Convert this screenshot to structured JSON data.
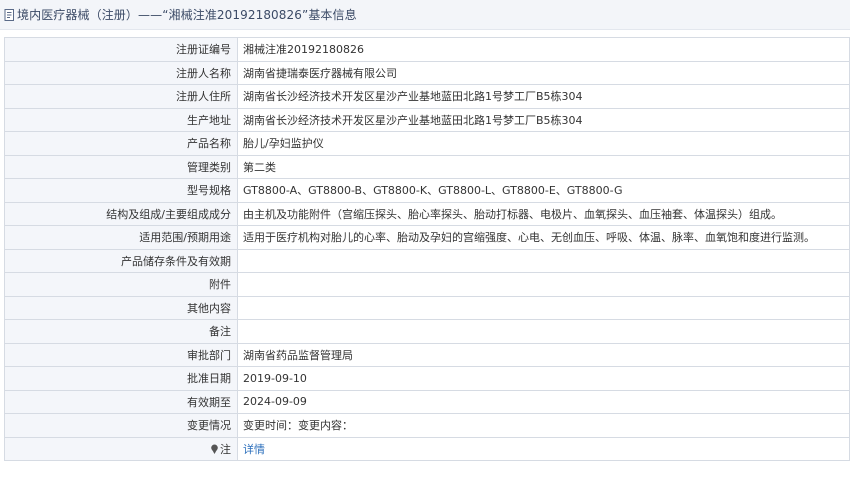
{
  "header": {
    "title": "境内医疗器械（注册）——“湘械注准20192180826”基本信息"
  },
  "rows": [
    {
      "label": "注册证编号",
      "value": "湘械注准20192180826"
    },
    {
      "label": "注册人名称",
      "value": "湖南省捷瑞泰医疗器械有限公司"
    },
    {
      "label": "注册人住所",
      "value": "湖南省长沙经济技术开发区星沙产业基地蓝田北路1号梦工厂B5栋304"
    },
    {
      "label": "生产地址",
      "value": "湖南省长沙经济技术开发区星沙产业基地蓝田北路1号梦工厂B5栋304"
    },
    {
      "label": "产品名称",
      "value": "胎儿/孕妇监护仪"
    },
    {
      "label": "管理类别",
      "value": "第二类"
    },
    {
      "label": "型号规格",
      "value": "GT8800-A、GT8800-B、GT8800-K、GT8800-L、GT8800-E、GT8800-G"
    },
    {
      "label": "结构及组成/主要组成成分",
      "value": "由主机及功能附件（宫缩压探头、胎心率探头、胎动打标器、电极片、血氧探头、血压袖套、体温探头）组成。"
    },
    {
      "label": "适用范围/预期用途",
      "value": "适用于医疗机构对胎儿的心率、胎动及孕妇的宫缩强度、心电、无创血压、呼吸、体温、脉率、血氧饱和度进行监测。"
    },
    {
      "label": "产品储存条件及有效期",
      "value": ""
    },
    {
      "label": "附件",
      "value": ""
    },
    {
      "label": "其他内容",
      "value": ""
    },
    {
      "label": "备注",
      "value": ""
    },
    {
      "label": "审批部门",
      "value": "湖南省药品监督管理局"
    },
    {
      "label": "批准日期",
      "value": "2019-09-10"
    },
    {
      "label": "有效期至",
      "value": "2024-09-09"
    },
    {
      "label": "变更情况",
      "value": "变更时间：变更内容："
    }
  ],
  "note_row": {
    "label": "注",
    "link_text": "详情",
    "icon": "pin-icon"
  },
  "colors": {
    "header_bg": "#f3f5f9",
    "label_bg": "#f4f6fa",
    "border": "#d6dbe3",
    "link": "#2a6ebb"
  }
}
